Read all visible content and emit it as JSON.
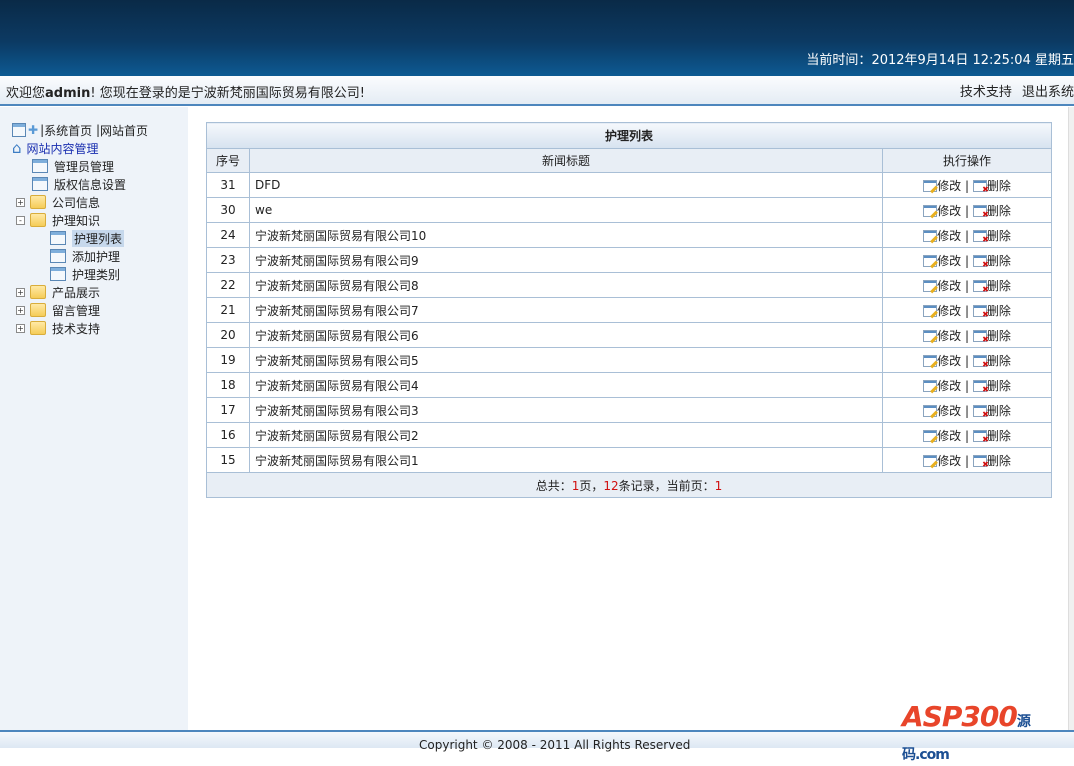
{
  "header": {
    "time_label": "当前时间：",
    "time_value": "2012年9月14日  12:25:04 星期五"
  },
  "welcome": {
    "prefix": "欢迎您",
    "user": "admin",
    "suffix": "! 您现在登录的是宁波新梵丽国际贸易有限公司!",
    "links": [
      "技术支持",
      "退出系统"
    ]
  },
  "sidebar": {
    "top_links": [
      "系统首页",
      "网站首页"
    ],
    "root": "网站内容管理",
    "items": [
      {
        "label": "管理员管理",
        "type": "page",
        "level": 1
      },
      {
        "label": "版权信息设置",
        "type": "page",
        "level": 1
      },
      {
        "label": "公司信息",
        "type": "folder",
        "level": 1,
        "toggle": "+"
      },
      {
        "label": "护理知识",
        "type": "folder",
        "level": 1,
        "toggle": "-"
      },
      {
        "label": "护理列表",
        "type": "page",
        "level": 2,
        "selected": true
      },
      {
        "label": "添加护理",
        "type": "page",
        "level": 2
      },
      {
        "label": "护理类别",
        "type": "page",
        "level": 2
      },
      {
        "label": "产品展示",
        "type": "folder",
        "level": 1,
        "toggle": "+"
      },
      {
        "label": "留言管理",
        "type": "folder",
        "level": 1,
        "toggle": "+"
      },
      {
        "label": "技术支持",
        "type": "folder",
        "level": 1,
        "toggle": "+"
      }
    ]
  },
  "table": {
    "title": "护理列表",
    "columns": [
      "序号",
      "新闻标题",
      "执行操作"
    ],
    "edit_label": "修改",
    "delete_label": "删除",
    "rows": [
      {
        "id": "31",
        "title": "DFD"
      },
      {
        "id": "30",
        "title": "we"
      },
      {
        "id": "24",
        "title": "宁波新梵丽国际贸易有限公司10"
      },
      {
        "id": "23",
        "title": "宁波新梵丽国际贸易有限公司9"
      },
      {
        "id": "22",
        "title": "宁波新梵丽国际贸易有限公司8"
      },
      {
        "id": "21",
        "title": "宁波新梵丽国际贸易有限公司7"
      },
      {
        "id": "20",
        "title": "宁波新梵丽国际贸易有限公司6"
      },
      {
        "id": "19",
        "title": "宁波新梵丽国际贸易有限公司5"
      },
      {
        "id": "18",
        "title": "宁波新梵丽国际贸易有限公司4"
      },
      {
        "id": "17",
        "title": "宁波新梵丽国际贸易有限公司3"
      },
      {
        "id": "16",
        "title": "宁波新梵丽国际贸易有限公司2"
      },
      {
        "id": "15",
        "title": "宁波新梵丽国际贸易有限公司1"
      }
    ],
    "pager": {
      "t1": "总共：",
      "pages": "1",
      "t2": "页，",
      "records": "12",
      "t3": "条记录，当前页：",
      "current": "1"
    }
  },
  "footer": {
    "copyright": "Copyright © 2008 - 2011 All Rights Reserved"
  },
  "logo": {
    "text": "ASP300",
    "sub": "源码.com"
  }
}
